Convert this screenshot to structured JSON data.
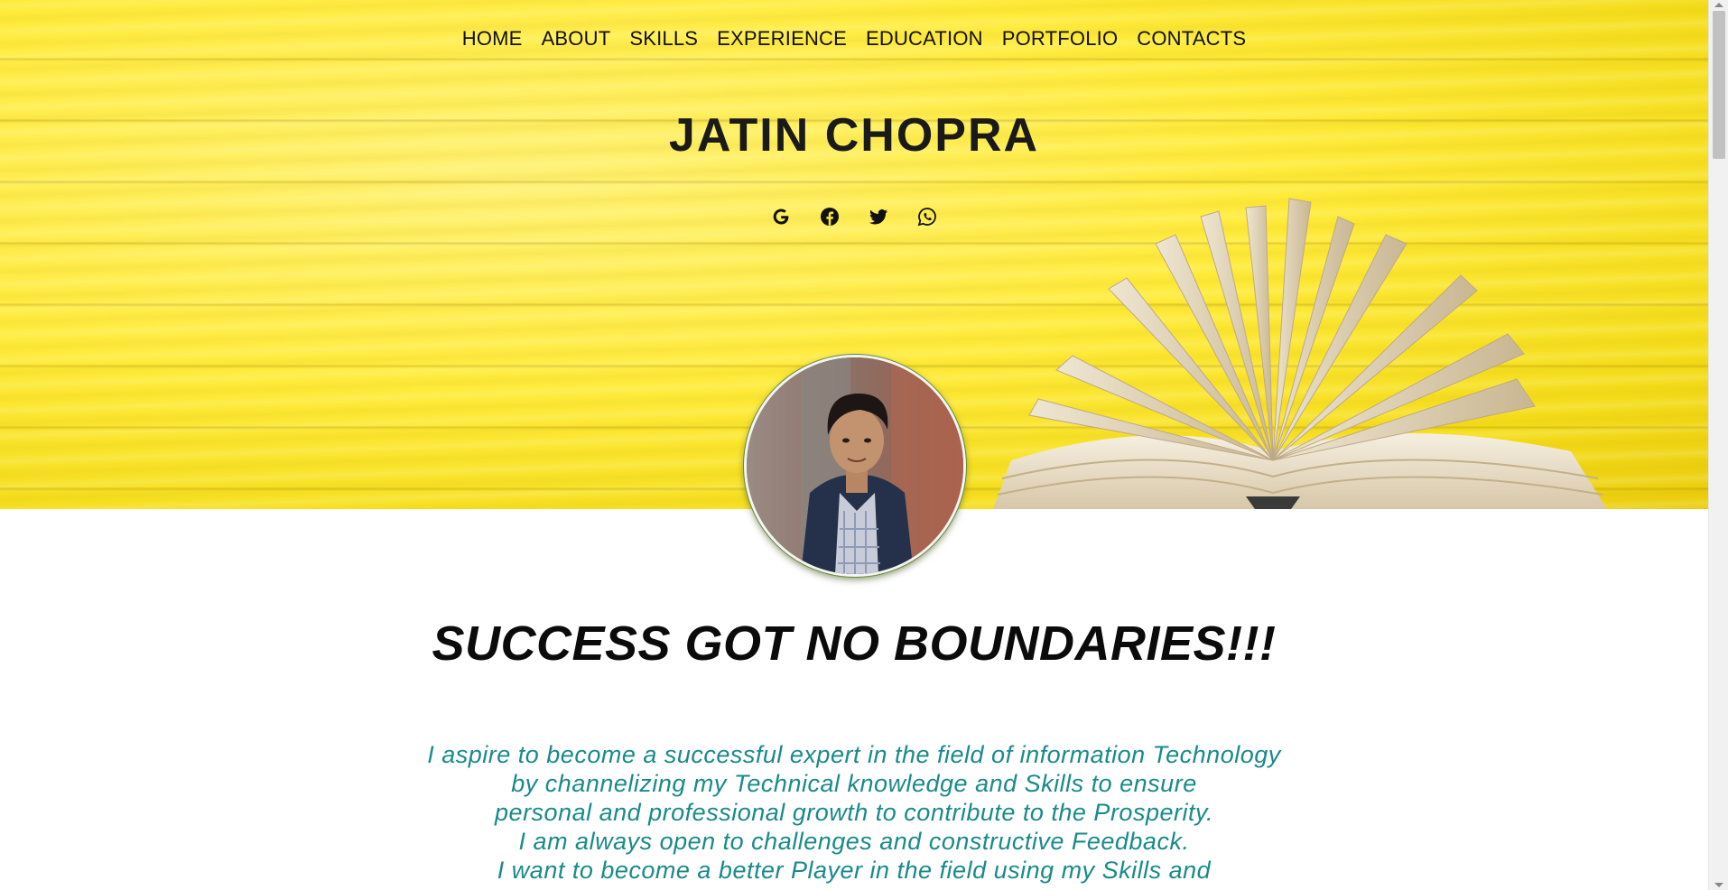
{
  "nav": {
    "items": [
      {
        "label": "HOME"
      },
      {
        "label": "ABOUT"
      },
      {
        "label": "SKILLS"
      },
      {
        "label": "EXPERIENCE"
      },
      {
        "label": "EDUCATION"
      },
      {
        "label": "PORTFOLIO"
      },
      {
        "label": "CONTACTS"
      }
    ]
  },
  "hero": {
    "name": "JATIN CHOPRA",
    "socials": [
      "google-icon",
      "facebook-icon",
      "twitter-icon",
      "whatsapp-icon"
    ],
    "background_color": "#ffeb3b"
  },
  "motto": "SUCCESS GOT NO BOUNDARIES!!!",
  "about": {
    "lines": [
      "I aspire to become a successful expert in the field of information Technology",
      "by channelizing my Technical knowledge and Skills to ensure",
      "personal and professional growth to contribute to the Prosperity.",
      "I am always open to challenges and constructive Feedback.",
      "I want to become a better Player in the field using my Skills and"
    ],
    "color": "#1a8a8a"
  }
}
